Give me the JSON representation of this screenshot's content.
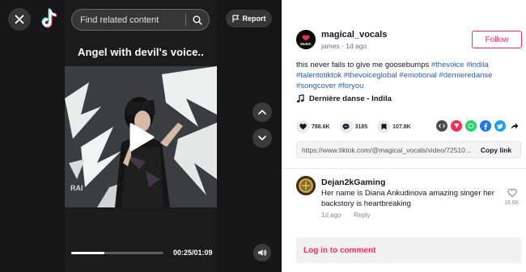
{
  "header": {
    "search_placeholder": "Find related content",
    "report_label": "Report"
  },
  "video": {
    "title": "Angel with devil's voice..",
    "watermark": "RAI",
    "time": "00:25/01:09",
    "progress": 0.36
  },
  "post": {
    "username": "magical_vocals",
    "subline": "james · 1d ago",
    "avatar_label": "MUSIC",
    "follow_label": "Follow",
    "description": "this never fails to give me goosebumps",
    "hashtags": [
      "#thevoice",
      "#indila",
      "#talentotiktok",
      "#thevoiceglobal",
      "#emotional",
      "#dernieredanse",
      "#songcover",
      "#foryou"
    ],
    "music": "Dernière danse - Indila",
    "likes": "788.6K",
    "comments": "3185",
    "saves": "107.8K",
    "link": "https://www.tiktok.com/@magical_vocals/video/72510...",
    "copy_label": "Copy link"
  },
  "comment": {
    "user": "Dejan2kGaming",
    "text": "Her name is Diana Ankudinova amazing singer her backstory is heartbreaking",
    "date": "1d ago",
    "reply_label": "Reply",
    "likes": "18.6K"
  },
  "login_label": "Log in to comment",
  "colors": {
    "accent": "#fe2c55",
    "hashtag": "#2b5db9",
    "player_bg": "#1b1b1b"
  }
}
